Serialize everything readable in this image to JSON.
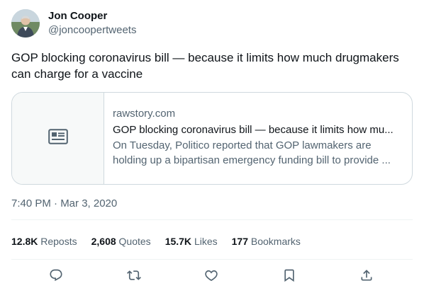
{
  "author": {
    "display_name": "Jon Cooper",
    "handle": "@joncoopertweets"
  },
  "tweet": {
    "text": "GOP blocking coronavirus bill — because it limits how much drugmakers can charge for a vaccine",
    "timestamp": "7:40 PM · Mar 3, 2020"
  },
  "card": {
    "domain": "rawstory.com",
    "title": "GOP blocking coronavirus bill — because it limits how mu...",
    "description": "On Tuesday, Politico reported that GOP lawmakers are holding up a bipartisan emergency funding bill to provide ...",
    "thumbnail_icon": "article-icon"
  },
  "stats": {
    "reposts_count": "12.8K",
    "reposts_label": "Reposts",
    "quotes_count": "2,608",
    "quotes_label": "Quotes",
    "likes_count": "15.7K",
    "likes_label": "Likes",
    "bookmarks_count": "177",
    "bookmarks_label": "Bookmarks"
  },
  "actions": [
    "reply-icon",
    "repost-icon",
    "like-icon",
    "bookmark-icon",
    "share-icon"
  ],
  "colors": {
    "text_primary": "#0f1419",
    "text_secondary": "#536471",
    "border": "#cfd9de",
    "divider": "#eff3f4"
  }
}
